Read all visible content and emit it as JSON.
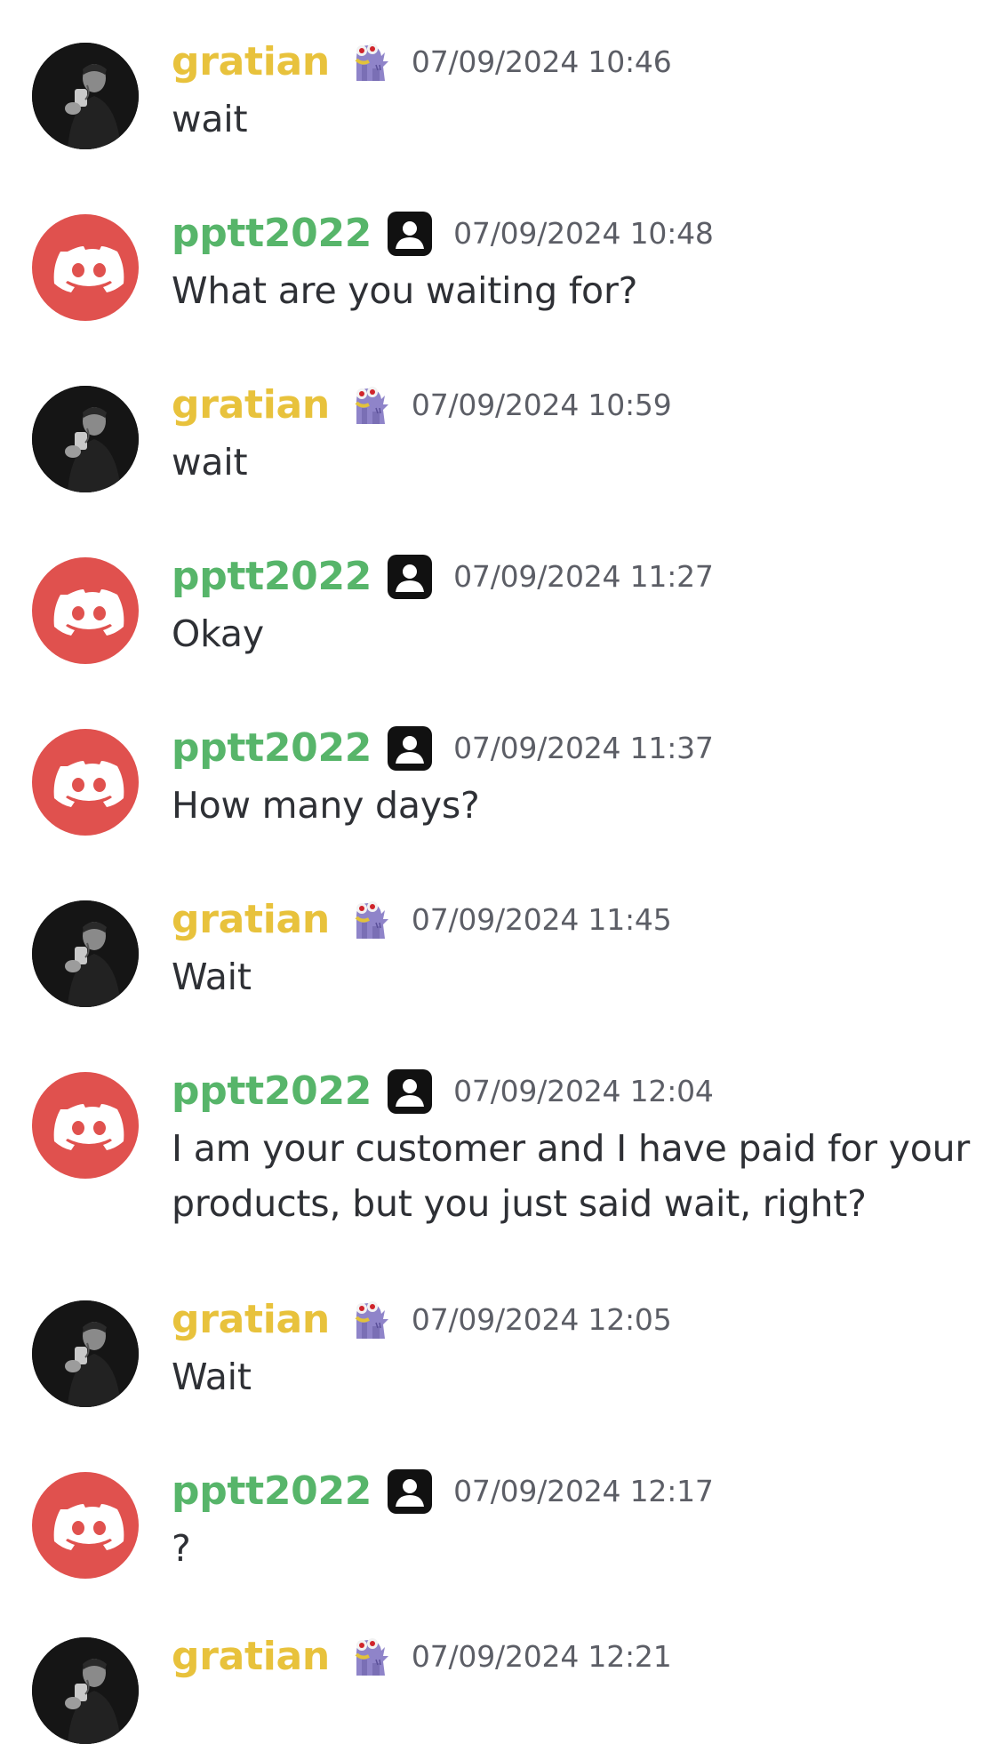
{
  "colors": {
    "gratian_name": "#e8c23c",
    "pptt_name": "#57b56a",
    "discord_red": "#e0514e",
    "timestamp": "#5c5e66",
    "text": "#2e3035"
  },
  "icons": {
    "gratian_avatar": "man-drinking-photo-avatar",
    "gratian_badge": "purple-monster-emoji-badge",
    "pptt_avatar": "discord-default-avatar-icon",
    "pptt_badge": "user-profile-badge-icon"
  },
  "messages": [
    {
      "author": "gratian",
      "timestamp": "07/09/2024 10:46",
      "text": "wait"
    },
    {
      "author": "pptt2022",
      "timestamp": "07/09/2024 10:48",
      "text": "What are you waiting for?"
    },
    {
      "author": "gratian",
      "timestamp": "07/09/2024 10:59",
      "text": "wait"
    },
    {
      "author": "pptt2022",
      "timestamp": "07/09/2024 11:27",
      "text": "Okay"
    },
    {
      "author": "pptt2022",
      "timestamp": "07/09/2024 11:37",
      "text": "How many days?"
    },
    {
      "author": "gratian",
      "timestamp": "07/09/2024 11:45",
      "text": "Wait"
    },
    {
      "author": "pptt2022",
      "timestamp": "07/09/2024 12:04",
      "text": "I am your customer and I have paid for your products, but you just said wait, right?"
    },
    {
      "author": "gratian",
      "timestamp": "07/09/2024 12:05",
      "text": "Wait"
    },
    {
      "author": "pptt2022",
      "timestamp": "07/09/2024 12:17",
      "text": "?"
    },
    {
      "author": "gratian",
      "timestamp": "07/09/2024 12:21",
      "text": ""
    }
  ]
}
